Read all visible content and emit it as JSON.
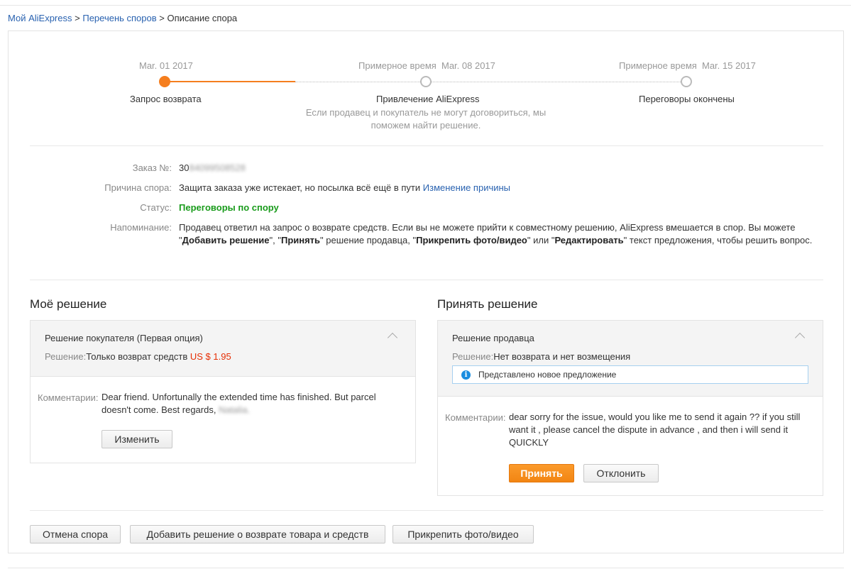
{
  "breadcrumb": {
    "items": [
      "Мой AliExpress",
      "Перечень споров",
      "Описание спора"
    ],
    "separator": ">"
  },
  "timeline": {
    "steps": [
      {
        "date_prefix": "",
        "date": "Mar. 01 2017",
        "label": "Запрос возврата",
        "active": true
      },
      {
        "date_prefix": "Примерное время",
        "date": "Mar. 08 2017",
        "label": "Привлечение AliExpress",
        "active": false
      },
      {
        "date_prefix": "Примерное время",
        "date": "Mar. 15 2017",
        "label": "Переговоры окончены",
        "active": false
      }
    ],
    "note": "Если продавец и покупатель не могут договориться, мы поможем найти решение.",
    "accent_color": "#f57e1e"
  },
  "info": {
    "order_label": "Заказ №:",
    "order_value_visible": "30",
    "order_value_blurred": "84099508528",
    "reason_label": "Причина спора:",
    "reason_value": "Защита заказа уже истекает, но посылка всё ещё в пути",
    "reason_link": "Изменение причины",
    "status_label": "Статус:",
    "status_value": "Переговоры по спору",
    "status_color": "#199b1b",
    "reminder_label": "Напоминание:",
    "reminder_parts": {
      "p1": "Продавец ответил на запрос о возврате средств. Если вы не можете прийти к совместному решению, AliExpress вмешается в спор. Вы можете \"",
      "b1": "Добавить решение",
      "p2": "\", \"",
      "b2": "Принять",
      "p3": "\" решение продавца, \"",
      "b3": "Прикрепить фото/видео",
      "p4": "\" или \"",
      "b4": "Редактировать",
      "p5": "\" текст предложения, чтобы решить вопрос."
    }
  },
  "my_solution": {
    "title": "Моё решение",
    "box_title": "Решение покупателя (Первая опция)",
    "decision_label": "Решение:",
    "decision_value": "Только возврат средств",
    "price": "US $ 1.95",
    "price_color": "#e62e04",
    "comment_label": "Комментарии:",
    "comment": "Dear friend. Unfortunally the extended time has finished. But parcel doesn't come. Best regards, ",
    "comment_blurred_name": "Natalia.",
    "edit_button": "Изменить"
  },
  "seller_solution": {
    "title": "Принять решение",
    "box_title": "Решение продавца",
    "decision_label": "Решение:",
    "decision_value": "Нет возврата и нет возмещения",
    "notice": "Представлено новое предложение",
    "notice_icon": "info-icon",
    "comment_label": "Комментарии:",
    "comment": "dear sorry for the issue, would you like me to send it again ?? if you still want it , please cancel the dispute in advance , and then i will send it QUICKLY",
    "accept_button": "Принять",
    "decline_button": "Отклонить"
  },
  "actions": {
    "cancel_dispute": "Отмена спора",
    "add_solution": "Добавить решение о возврате товара и средств",
    "attach_media": "Прикрепить фото/видео"
  }
}
